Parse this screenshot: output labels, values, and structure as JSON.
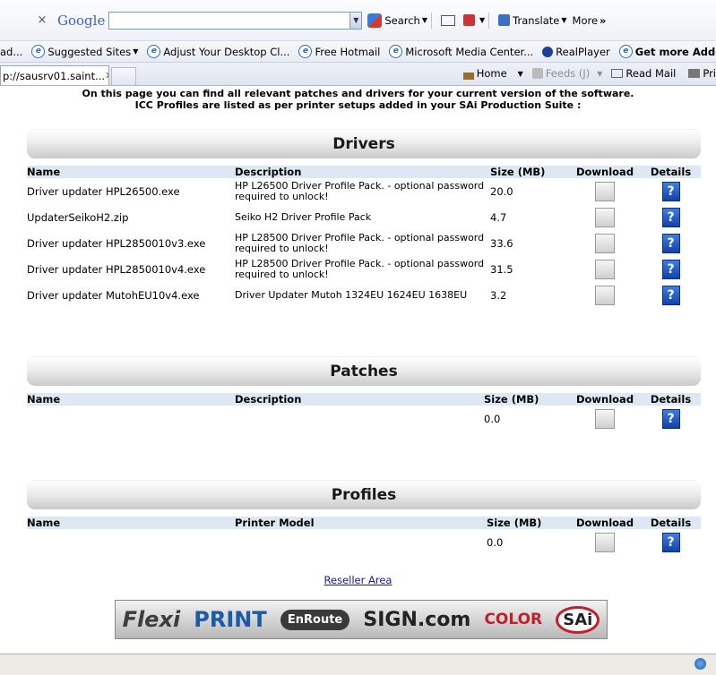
{
  "toolbar": {
    "google_logo": "Google",
    "search_value": "",
    "search_button": "Search",
    "translate": "Translate",
    "more": "More"
  },
  "favorites": {
    "cut_item": "ad...",
    "items": [
      "Suggested Sites",
      "Adjust Your Desktop Cl...",
      "Free Hotmail",
      "Microsoft Media Center...",
      "RealPlayer",
      "Get more Add-ons"
    ]
  },
  "tabs": {
    "active_tab": "p://sausrv01.saint...",
    "home": "Home",
    "feeds": "Feeds (J)",
    "read_mail": "Read Mail",
    "print_cut": "Pri"
  },
  "intro": {
    "line1": "On this page you can find all relevant patches and drivers for your current version of the software.",
    "line2": "ICC Profiles are listed as per printer setups added in your SAi Production Suite :"
  },
  "drivers": {
    "title": "Drivers",
    "headers": [
      "Name",
      "Description",
      "Size (MB)",
      "Download",
      "Details"
    ],
    "rows": [
      {
        "name": "Driver updater HPL26500.exe",
        "desc": "HP L26500 Driver Profile Pack. - optional password required to unlock!",
        "size": "20.0"
      },
      {
        "name": "UpdaterSeikoH2.zip",
        "desc": "Seiko H2 Driver Profile Pack",
        "size": "4.7"
      },
      {
        "name": "Driver updater HPL2850010v3.exe",
        "desc": "HP L28500 Driver Profile Pack. - optional password required to unlock!",
        "size": "33.6"
      },
      {
        "name": "Driver updater HPL2850010v4.exe",
        "desc": "HP L28500 Driver Profile Pack. - optional password required to unlock!",
        "size": "31.5"
      },
      {
        "name": "Driver updater MutohEU10v4.exe",
        "desc": "Driver Updater Mutoh 1324EU 1624EU 1638EU",
        "size": "3.2"
      }
    ]
  },
  "patches": {
    "title": "Patches",
    "headers": [
      "Name",
      "Description",
      "Size (MB)",
      "Download",
      "Details"
    ],
    "rows": [
      {
        "name": "",
        "desc": "",
        "size": "0.0"
      }
    ]
  },
  "profiles": {
    "title": "Profiles",
    "headers": [
      "Name",
      "Printer Model",
      "Size (MB)",
      "Download",
      "Details"
    ],
    "rows": [
      {
        "name": "",
        "desc": "",
        "size": "0.0"
      }
    ]
  },
  "reseller_link": "Reseller Area",
  "banner": [
    "Flexi",
    "PRINT",
    "EnRoute",
    "SIGN.com",
    "COLOR",
    "SAi"
  ],
  "colors": {
    "header_row": "#dde8f4",
    "link": "#1a1aa6",
    "details_icon": "#1e55c8"
  }
}
